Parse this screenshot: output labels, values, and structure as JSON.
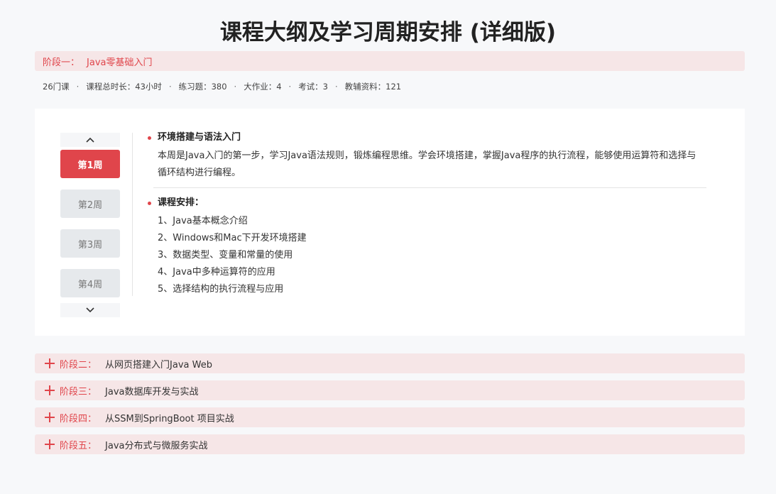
{
  "page_title": "课程大纲及学习周期安排 (详细版)",
  "stage1": {
    "label": "阶段一：",
    "name": "Java零基础入门"
  },
  "stats": [
    "26门课",
    "课程总时长：43小时",
    "练习题：380",
    "大作业：4",
    "考试：3",
    "教辅资料：121"
  ],
  "stats_separator": "·",
  "weeks": [
    "第1周",
    "第2周",
    "第3周",
    "第4周"
  ],
  "active_week": "第1周",
  "content": {
    "title": "环境搭建与语法入门",
    "description": "本周是Java入门的第一步，学习Java语法规则，锻炼编程思维。学会环境搭建，掌握Java程序的执行流程，能够使用运算符和选择与循环结构进行编程。",
    "schedule_title": "课程安排：",
    "schedule": [
      "1、Java基本概念介绍",
      "2、Windows和Mac下开发环境搭建",
      "3、数据类型、变量和常量的使用",
      "4、Java中多种运算符的应用",
      "5、选择结构的执行流程与应用"
    ]
  },
  "stages": [
    {
      "label": "阶段二：",
      "name": "从网页搭建入门Java Web"
    },
    {
      "label": "阶段三：",
      "name": "Java数据库开发与实战"
    },
    {
      "label": "阶段四：",
      "name": "从SSM到SpringBoot 项目实战"
    },
    {
      "label": "阶段五：",
      "name": "Java分布式与微服务实战"
    }
  ],
  "icons": {
    "up": "chevron-up-icon",
    "down": "chevron-down-icon",
    "expand": "plus-icon"
  },
  "colors": {
    "accent": "#e0454b",
    "stage_bg": "#f6e6e7",
    "page_bg": "#f7f8fa"
  }
}
